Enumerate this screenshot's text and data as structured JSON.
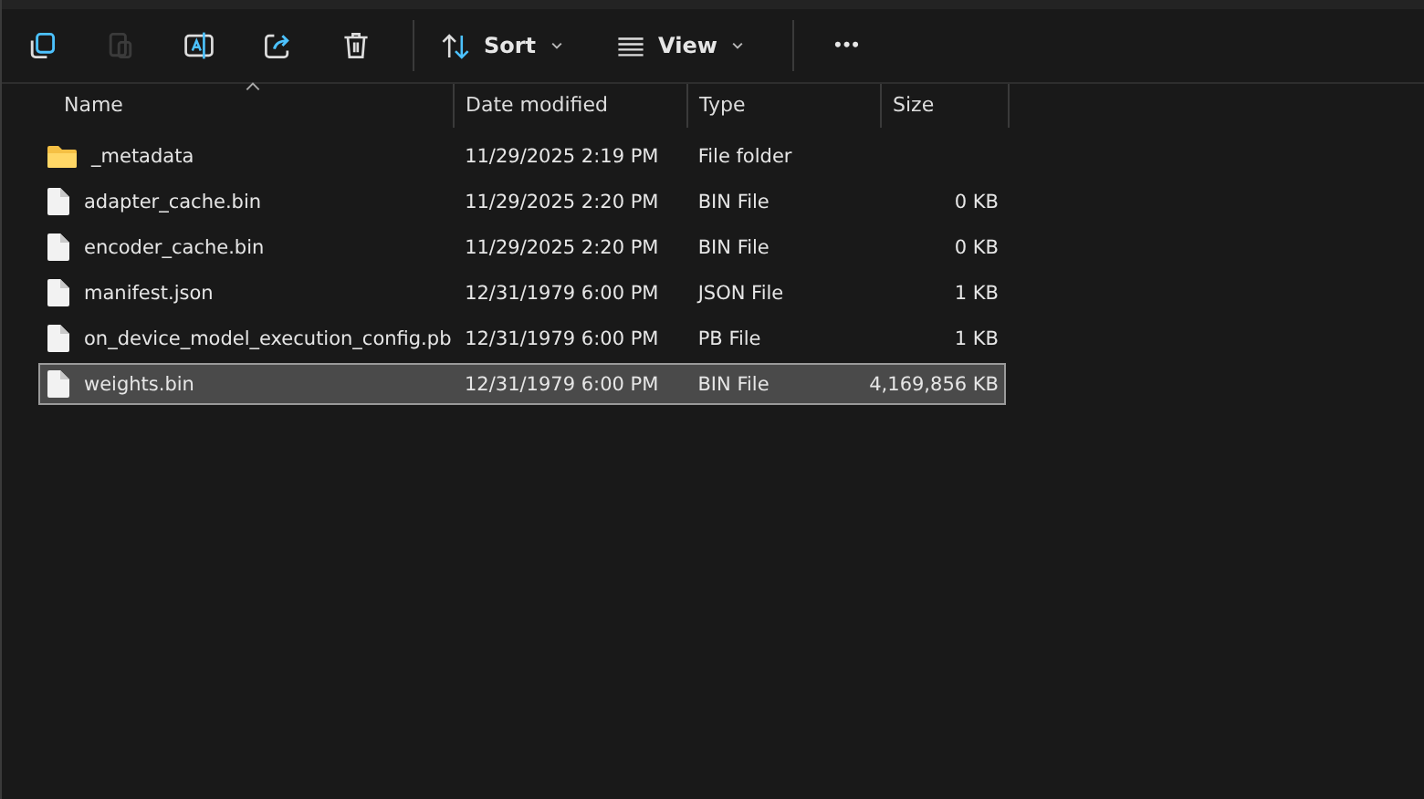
{
  "toolbar": {
    "icon_buttons": [
      {
        "kind": "copy",
        "disabled": false
      },
      {
        "kind": "paste",
        "disabled": true
      },
      {
        "kind": "rename",
        "disabled": false
      },
      {
        "kind": "share",
        "disabled": false
      },
      {
        "kind": "delete",
        "disabled": false
      }
    ],
    "menus": [
      {
        "kind": "sort",
        "label": "Sort"
      },
      {
        "kind": "view",
        "label": "View"
      }
    ],
    "more": "•••"
  },
  "table": {
    "columns": [
      {
        "label": "Name",
        "sorted": true
      },
      {
        "label": "Date modified",
        "sorted": false
      },
      {
        "label": "Type",
        "sorted": false
      },
      {
        "label": "Size",
        "sorted": false
      }
    ],
    "rows": [
      {
        "kind": "folder",
        "name": "_metadata",
        "date": "11/29/2025 2:19 PM",
        "type": "File folder",
        "size": "",
        "selected": false
      },
      {
        "kind": "file",
        "name": "adapter_cache.bin",
        "date": "11/29/2025 2:20 PM",
        "type": "BIN File",
        "size": "0 KB",
        "selected": false
      },
      {
        "kind": "file",
        "name": "encoder_cache.bin",
        "date": "11/29/2025 2:20 PM",
        "type": "BIN File",
        "size": "0 KB",
        "selected": false
      },
      {
        "kind": "file",
        "name": "manifest.json",
        "date": "12/31/1979 6:00 PM",
        "type": "JSON File",
        "size": "1 KB",
        "selected": false
      },
      {
        "kind": "file",
        "name": "on_device_model_execution_config.pb",
        "date": "12/31/1979 6:00 PM",
        "type": "PB File",
        "size": "1 KB",
        "selected": false
      },
      {
        "kind": "file",
        "name": "weights.bin",
        "date": "12/31/1979 6:00 PM",
        "type": "BIN File",
        "size": "4,169,856 KB",
        "selected": true
      }
    ]
  }
}
